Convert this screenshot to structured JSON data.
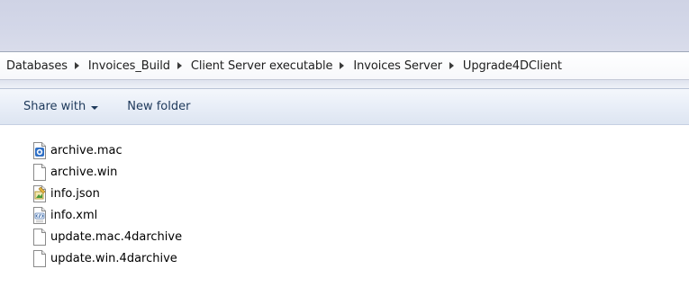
{
  "breadcrumb": {
    "items": [
      "Databases",
      "Invoices_Build",
      "Client Server executable",
      "Invoices Server",
      "Upgrade4DClient"
    ]
  },
  "toolbar": {
    "share_label": "Share with",
    "new_folder_label": "New folder"
  },
  "files": [
    {
      "name": "archive.mac",
      "icon": "mac-archive-icon"
    },
    {
      "name": "archive.win",
      "icon": "blank-file-icon"
    },
    {
      "name": "info.json",
      "icon": "json-file-icon"
    },
    {
      "name": "info.xml",
      "icon": "xml-file-icon"
    },
    {
      "name": "update.mac.4darchive",
      "icon": "blank-file-icon"
    },
    {
      "name": "update.win.4darchive",
      "icon": "blank-file-icon"
    }
  ],
  "colors": {
    "title_bar": "#d3d7e8",
    "toolbar_text": "#1e395b",
    "toolbar_bg": "#e7edf7"
  }
}
